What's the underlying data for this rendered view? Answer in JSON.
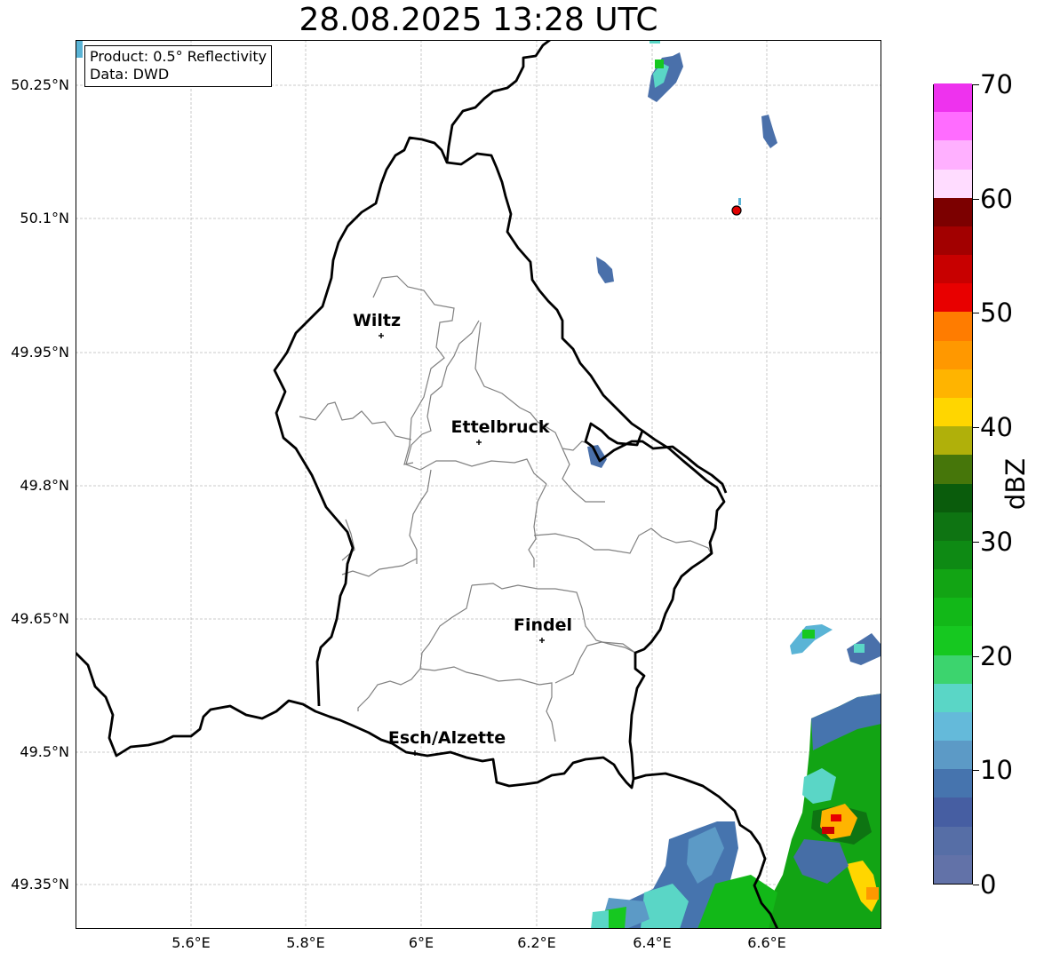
{
  "title": "28.08.2025 13:28 UTC",
  "info": {
    "product": "Product: 0.5° Reflectivity",
    "data": "Data: DWD"
  },
  "axes": {
    "lat_ticks": [
      "50.25°N",
      "50.1°N",
      "49.95°N",
      "49.8°N",
      "49.65°N",
      "49.5°N",
      "49.35°N"
    ],
    "lon_ticks": [
      "5.6°E",
      "5.8°E",
      "6°E",
      "6.2°E",
      "6.4°E",
      "6.6°E"
    ]
  },
  "cities": [
    {
      "name": "Wiltz",
      "lat": 49.97,
      "lon": 5.93
    },
    {
      "name": "Ettelbruck",
      "lat": 49.85,
      "lon": 6.1
    },
    {
      "name": "Findel",
      "lat": 49.63,
      "lon": 6.21
    },
    {
      "name": "Esch/Alzette",
      "lat": 49.5,
      "lon": 5.99
    }
  ],
  "radar_site": {
    "lat": 50.11,
    "lon": 6.55,
    "color": "#e00000"
  },
  "colorbar": {
    "label": "dBZ",
    "ticks": [
      "0",
      "10",
      "20",
      "30",
      "40",
      "50",
      "60",
      "70"
    ],
    "min": 0,
    "max": 70,
    "colors": [
      "#6272a8",
      "#566ea6",
      "#465ea2",
      "#4674ae",
      "#5c9ac6",
      "#64bada",
      "#5ad6c6",
      "#3cd46e",
      "#16c820",
      "#12b818",
      "#12a414",
      "#0e8a14",
      "#0e7412",
      "#0a5c0c",
      "#46760a",
      "#b0b00a",
      "#ffd600",
      "#ffb400",
      "#ff9800",
      "#ff7c00",
      "#e80000",
      "#c80000",
      "#a20000",
      "#7c0000",
      "#ffdcff",
      "#ffb0ff",
      "#ff6cff",
      "#ee32ee"
    ]
  },
  "colors": {
    "border": "#000000",
    "cantons": "#808080",
    "grid": "#bbbbbb"
  }
}
